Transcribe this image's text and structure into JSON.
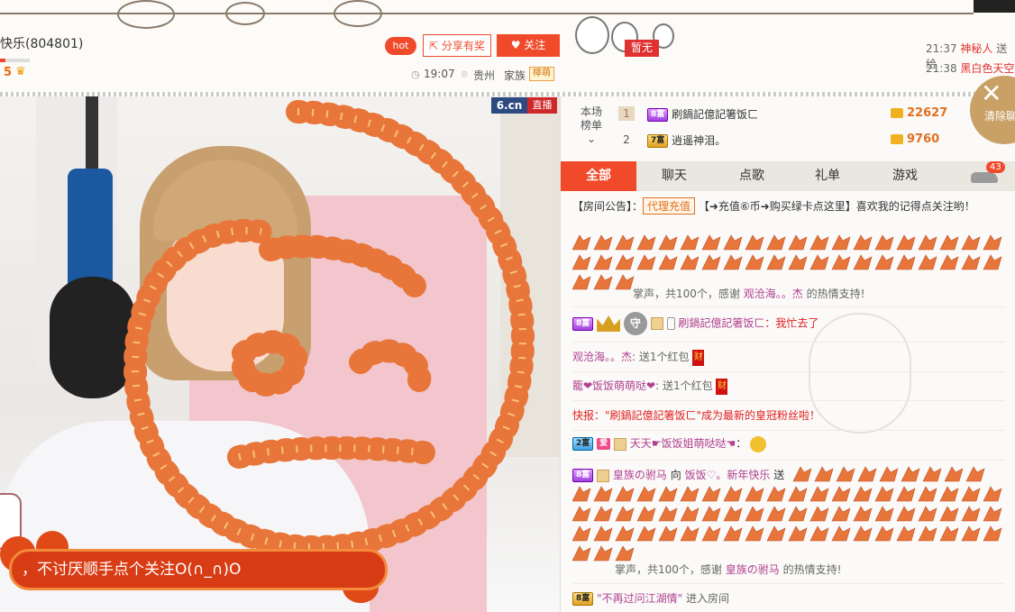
{
  "header": {
    "room_title": "快乐(804801)",
    "level": "5",
    "hot_label": "hot",
    "share_label": "分享有奖",
    "follow_label": "关注",
    "time": "19:07",
    "location": "贵州",
    "family_label": "家族",
    "family_badge": "檸萌",
    "none_badge": "暂无",
    "feed": [
      {
        "time": "21:37",
        "who": "神秘人",
        "text": "送给"
      },
      {
        "time": "21:38",
        "who": "黑白色天空"
      }
    ]
  },
  "video": {
    "logo": "6.cn",
    "live_label": "直播",
    "banner_text": "，不讨厌顺手点个关注O(∩_∩)O"
  },
  "ranking": {
    "label_line1": "本场",
    "label_line2": "榜单",
    "rows": [
      {
        "rank": "1",
        "level": "8富",
        "name": "刷鍋記億記箸饭ㄈ",
        "score": "22627"
      },
      {
        "rank": "2",
        "level": "7富",
        "name": "逍遥神泪。",
        "score": "9760"
      }
    ]
  },
  "tabs": [
    "全部",
    "聊天",
    "点歌",
    "礼单",
    "游戏"
  ],
  "car_count": "43",
  "clear_label": "清除聊",
  "notice": {
    "prefix": "【房间公告】：",
    "tag": "代理充值",
    "text": "【➜充值⑥币➜购买绿卡点这里】喜欢我的记得点关注哟！"
  },
  "messages": {
    "applause1": {
      "pre": "掌声，共100个，感谢",
      "name": "观沧海。。杰",
      "post": "的热情支持!"
    },
    "chat1": {
      "level": "8富",
      "name": "刷鍋記億記箸饭ㄈ",
      "text": "：我忙去了"
    },
    "red1": {
      "name": "观沧海。。杰",
      "text": ": 送1个红包",
      "icon": "财"
    },
    "red2": {
      "name": "籠❤饭饭萌萌哒❤",
      "text": ": 送1个红包",
      "icon": "财"
    },
    "flash": {
      "text": "快报：\"刷鍋記億記箸饭ㄈ\"成为最新的皇冠粉丝啦！"
    },
    "chat2": {
      "level": "2富",
      "badge": "爱",
      "name": "天天☛饭饭姐萌哒哒☚",
      "text": "："
    },
    "gift": {
      "level": "8富",
      "name": "皇族の驸马",
      "mid": "向",
      "target": "饭饭♡。新年快乐",
      "send": "送"
    },
    "applause2": {
      "pre": "掌声，共100个，感谢",
      "name": "皇族の驸马",
      "post": "的热情支持!"
    },
    "enter": {
      "level": "8富",
      "name": "\"不再过问江湖情\"",
      "text": "进入房间"
    }
  },
  "colors": {
    "accent": "#f04a2a",
    "name": "#b04090",
    "alert": "#e02020",
    "score": "#e07020"
  }
}
